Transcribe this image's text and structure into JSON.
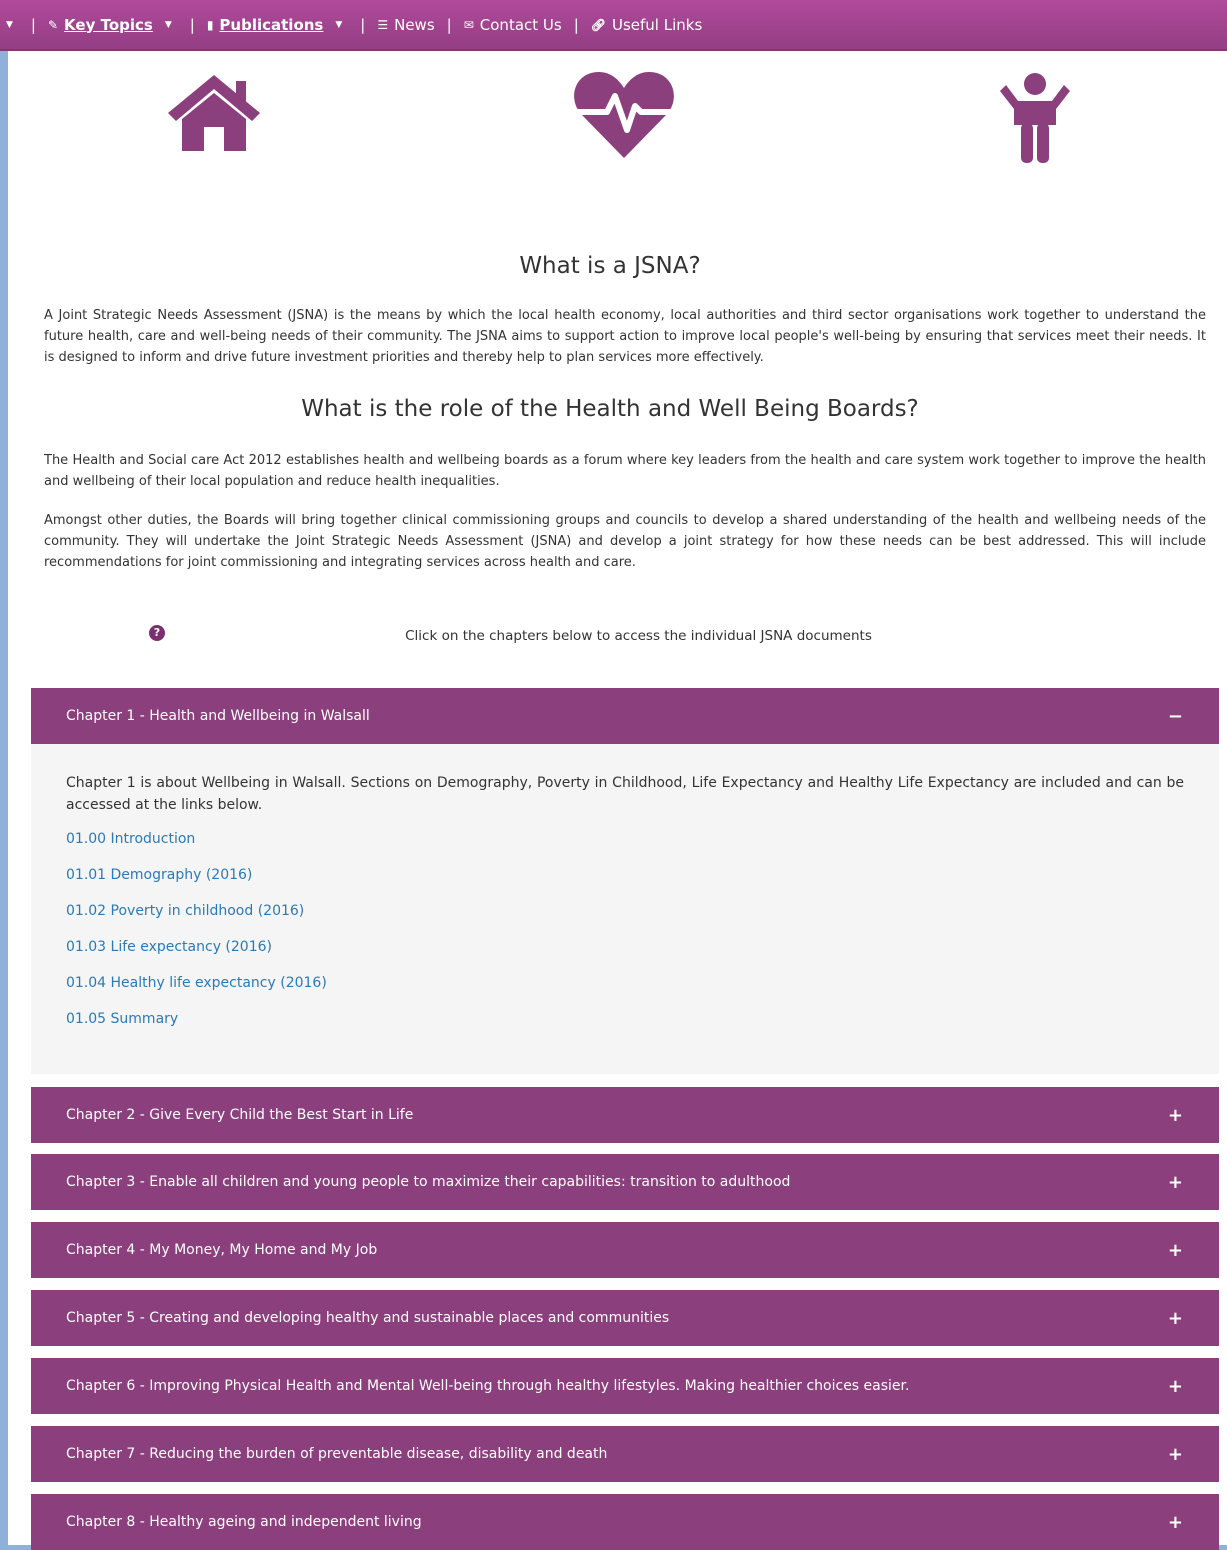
{
  "nav": {
    "items": [
      {
        "label": "Key Topics",
        "icon": "wrench-icon"
      },
      {
        "label": "Publications",
        "icon": "document-icon"
      },
      {
        "label": "News",
        "icon": "list-icon"
      },
      {
        "label": "Contact Us",
        "icon": "envelope-icon"
      },
      {
        "label": "Useful Links",
        "icon": "link-icon"
      }
    ]
  },
  "colors": {
    "accent": "#8b3f7d",
    "link": "#2a7ab8",
    "nav": "#a44490"
  },
  "intro": {
    "title": "What is a JSNA?",
    "text": "A Joint Strategic Needs Assessment (JSNA) is the means by which the local health economy, local authorities and third sector organisations work together to understand the future health, care and well-being needs of their community. The JSNA aims to support action to improve local people's well-being by ensuring that services meet their needs. It is designed to inform and drive future investment priorities and thereby help to plan services more effectively."
  },
  "role": {
    "title": "What is the role of the Health and Well Being Boards?",
    "text1": "The Health and Social care Act 2012 establishes health and wellbeing boards as a forum where key leaders from the health and care system work together to improve the health and wellbeing of their local population and reduce health inequalities.",
    "text2": "Amongst other duties, the Boards will bring together clinical commissioning groups and councils to develop a shared understanding of the health and wellbeing needs of the community. They will undertake the Joint Strategic Needs Assessment (JSNA) and develop a joint strategy for how these needs can be best addressed. This will include recommendations for joint commissioning and integrating services across health and care."
  },
  "help": {
    "icon": "question-icon",
    "text": "Click on the chapters below to access the individual JSNA documents"
  },
  "chapters": [
    {
      "title": "Chapter 1 - Health and Wellbeing in Walsall",
      "toggle": "−",
      "description": "Chapter 1 is about Wellbeing in Walsall. Sections on Demography, Poverty in Childhood, Life Expectancy and Healthy Life Expectancy are included and can be accessed at the links below.",
      "links": [
        "01.00 Introduction",
        "01.01 Demography (2016)",
        "01.02 Poverty in childhood (2016)",
        "01.03 Life expectancy (2016)",
        "01.04 Healthy life expectancy (2016)",
        "01.05 Summary"
      ]
    },
    {
      "title": "Chapter 2 - Give Every Child the Best Start in Life",
      "toggle": "+"
    },
    {
      "title": "Chapter 3 - Enable all children and young people to maximize their capabilities: transition to adulthood",
      "toggle": "+"
    },
    {
      "title": "Chapter 4 - My Money, My Home and My Job",
      "toggle": "+"
    },
    {
      "title": "Chapter 5 - Creating and developing healthy and sustainable places and communities",
      "toggle": "+"
    },
    {
      "title": "Chapter 6 - Improving Physical Health and Mental Well-being through healthy lifestyles. Making healthier choices easier.",
      "toggle": "+"
    },
    {
      "title": "Chapter 7 - Reducing the burden of preventable disease, disability and death",
      "toggle": "+"
    },
    {
      "title": "Chapter 8 - Healthy ageing and independent living",
      "toggle": "+"
    }
  ]
}
